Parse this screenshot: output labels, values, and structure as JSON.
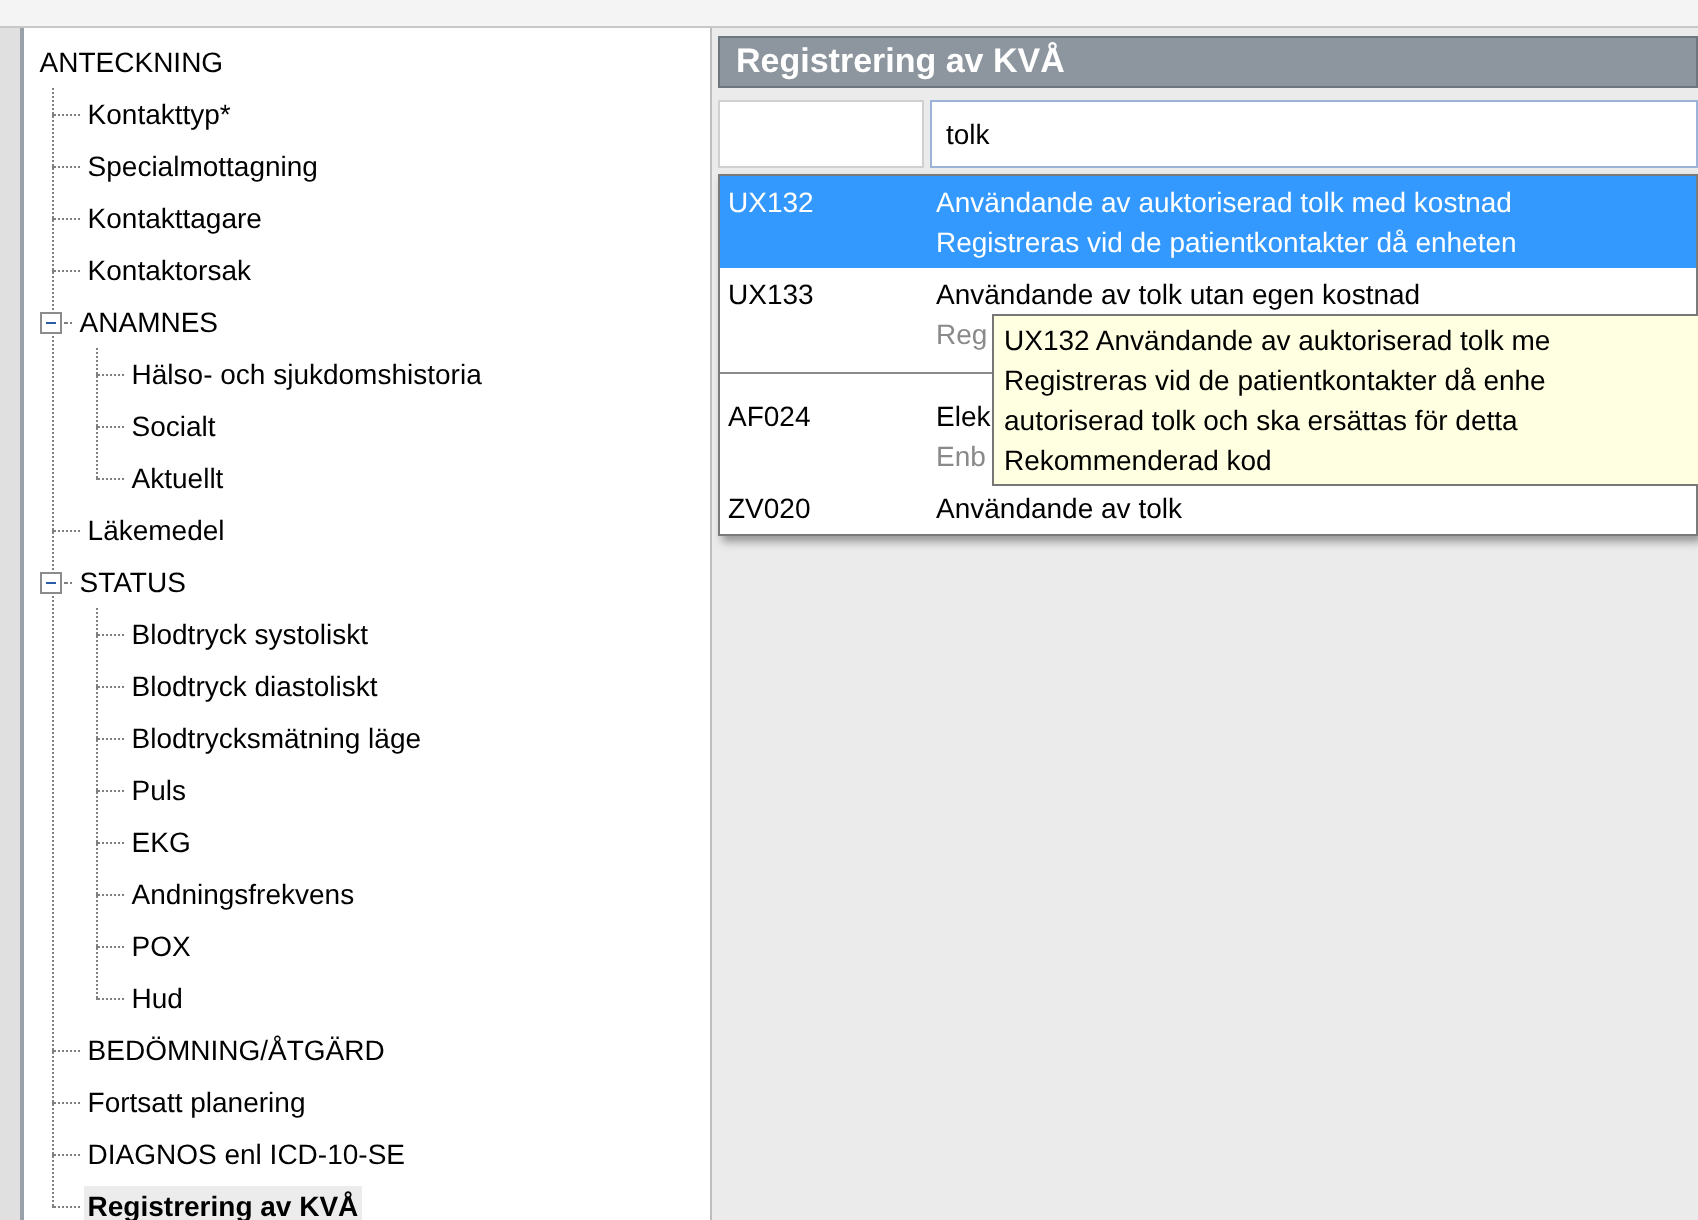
{
  "tree": {
    "label": "ANTECKNING",
    "children": [
      {
        "label": "Kontakttyp*",
        "selected": false
      },
      {
        "label": "Specialmottagning",
        "selected": false
      },
      {
        "label": "Kontakttagare",
        "selected": false
      },
      {
        "label": "Kontaktorsak",
        "selected": false
      },
      {
        "label": "ANAMNES",
        "selected": false,
        "expanded": true,
        "children": [
          {
            "label": "Hälso- och sjukdomshistoria",
            "selected": false
          },
          {
            "label": "Socialt",
            "selected": false
          },
          {
            "label": "Aktuellt",
            "selected": false
          }
        ]
      },
      {
        "label": "Läkemedel",
        "selected": false
      },
      {
        "label": "STATUS",
        "selected": false,
        "expanded": true,
        "children": [
          {
            "label": "Blodtryck systoliskt",
            "selected": false
          },
          {
            "label": "Blodtryck diastoliskt",
            "selected": false
          },
          {
            "label": "Blodtrycksmätning läge",
            "selected": false
          },
          {
            "label": "Puls",
            "selected": false
          },
          {
            "label": "EKG",
            "selected": false
          },
          {
            "label": "Andningsfrekvens",
            "selected": false
          },
          {
            "label": "POX",
            "selected": false
          },
          {
            "label": "Hud",
            "selected": false
          }
        ]
      },
      {
        "label": "BEDÖMNING/ÅTGÄRD",
        "selected": false
      },
      {
        "label": "Fortsatt planering",
        "selected": false
      },
      {
        "label": "DIAGNOS enl ICD-10-SE",
        "selected": false
      },
      {
        "label": "Registrering av KVÅ",
        "selected": true
      }
    ]
  },
  "panel": {
    "title": "Registrering av KVÅ",
    "search": {
      "value": "tolk"
    },
    "groups": [
      {
        "rows": [
          {
            "code": "UX132",
            "title": "Användande av auktoriserad tolk med kostnad",
            "subtitle": "Registreras vid de patientkontakter då enheten",
            "selected": true
          },
          {
            "code": "UX133",
            "title": "Användande av tolk utan egen kostnad",
            "subtitle": "Reg",
            "selected": false
          }
        ]
      },
      {
        "rows": [
          {
            "code": "AF024",
            "title": "Elek",
            "subtitle": "Enb",
            "selected": false
          },
          {
            "code": "ZV020",
            "title": "Användande av tolk",
            "selected": false
          }
        ]
      }
    ],
    "tooltip": {
      "lines": [
        "UX132 Användande av auktoriserad tolk me",
        "Registreras vid de patientkontakter då enhe",
        "autoriserad tolk och ska ersättas för detta",
        "Rekommenderad kod"
      ]
    }
  }
}
